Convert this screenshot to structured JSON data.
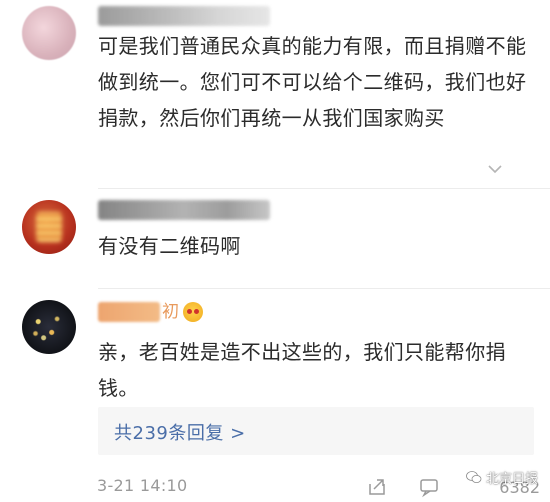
{
  "comments": [
    {
      "text": "可是我们普通民众真的能力有限，而且捐赠不能做到统一。您们可不可以给个二维码，我们也好捐款，然后你们再统一从我们国家购买"
    },
    {
      "text": "有没有二维码啊"
    },
    {
      "name_suffix": "初",
      "text": "亲，老百姓是造不出这些的，我们只能帮你捐钱。"
    }
  ],
  "replies": {
    "label": "共239条回复 >"
  },
  "footer": {
    "timestamp": "3-21 14:10",
    "like_count": "6382"
  },
  "watermark": {
    "text": "北京日报"
  },
  "colors": {
    "link": "#4a6ea8",
    "meta_gray": "#9a9a9a"
  }
}
